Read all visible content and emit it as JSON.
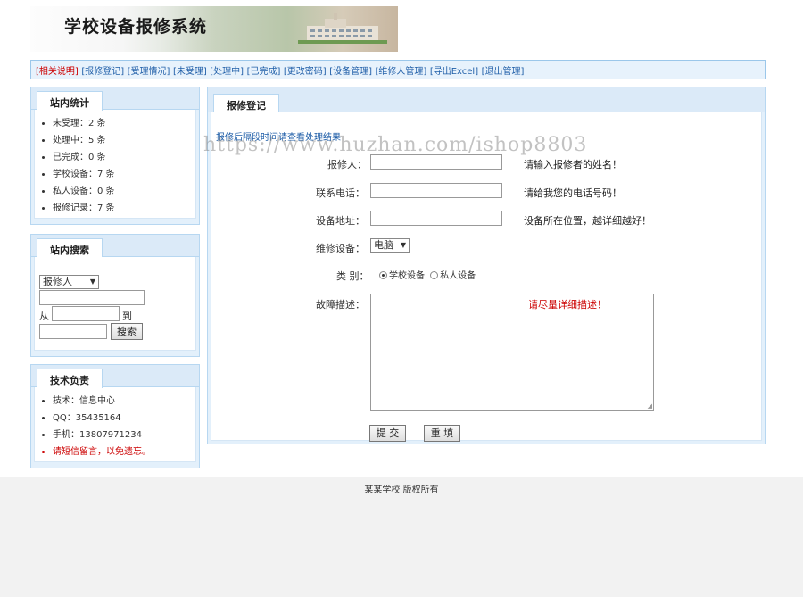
{
  "header": {
    "title": "学校设备报修系统"
  },
  "nav": {
    "items": [
      "[相关说明]",
      "[报修登记]",
      "[受理情况]",
      "[未受理]",
      "[处理中]",
      "[已完成]",
      "[更改密码]",
      "[设备管理]",
      "[维修人管理]",
      "[导出Excel]",
      "[退出管理]"
    ]
  },
  "stats": {
    "title": "站内统计",
    "items": [
      "未受理：2 条",
      "处理中：5 条",
      "已完成：0 条",
      "学校设备：7 条",
      "私人设备：0 条",
      "报修记录：7 条"
    ]
  },
  "search": {
    "title": "站内搜索",
    "field_select": "报修人",
    "from_label": "从",
    "to_label": "到",
    "button": "搜索"
  },
  "tech": {
    "title": "技术负责",
    "items": [
      "技术：信息中心",
      "QQ：35435164",
      "手机：13807971234",
      "请短信留言，以免遗忘。"
    ]
  },
  "form": {
    "tab": "报修登记",
    "notice": "报修后隔段时间请查看处理结果",
    "reporter_label": "报修人：",
    "reporter_hint": "请输入报修者的姓名！",
    "phone_label": "联系电话：",
    "phone_hint": "请给我您的电话号码！",
    "address_label": "设备地址：",
    "address_hint": "设备所在位置，越详细越好！",
    "device_label": "维修设备：",
    "device_value": "电脑",
    "type_label": "类 别：",
    "type_options": [
      "学校设备",
      "私人设备"
    ],
    "type_selected": "学校设备",
    "desc_label": "故障描述：",
    "desc_placeholder": "请尽量详细描述！",
    "submit": "提 交",
    "reset": "重 填"
  },
  "watermark": "https://www.huzhan.com/ishop8803",
  "footer": "某某学校 版权所有"
}
